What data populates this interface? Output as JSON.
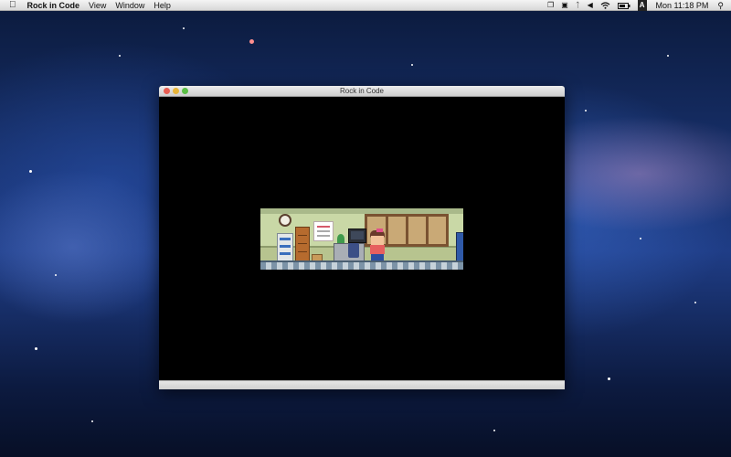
{
  "menubar": {
    "apple_icon": "apple-icon",
    "app_name": "Rock in Code",
    "menus": [
      "View",
      "Window",
      "Help"
    ],
    "status_icons": [
      "window-switch-icon",
      "display-icon",
      "bluetooth-icon",
      "volume-icon",
      "wifi-icon",
      "battery-icon",
      "input-source-icon"
    ],
    "input_source": "A",
    "clock": "Mon 11:18 PM",
    "search_icon": "search-icon"
  },
  "window": {
    "title": "Rock in Code",
    "controls": [
      "close",
      "minimize",
      "zoom"
    ]
  },
  "colors": {
    "close": "#e85d52",
    "minimize": "#e8b53a",
    "zoom": "#5bbf45",
    "game_background": "#000000"
  }
}
